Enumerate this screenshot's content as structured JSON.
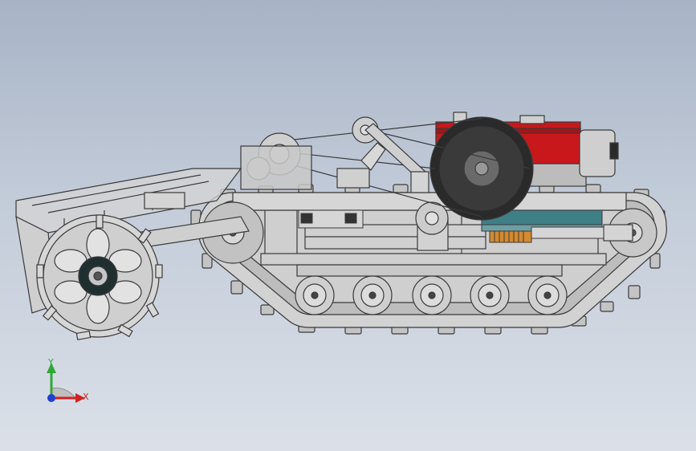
{
  "scene": {
    "background_top": "#a7b3c6",
    "background_bottom": "#dbe0e8",
    "part_fill": "#c9c9c9",
    "part_stroke": "#3a3a3a",
    "engine_color": "#c8181b",
    "hub_color": "#1f2f30",
    "cylinder_color": "#3f7f86",
    "spring_color": "#d58a2d"
  },
  "triad": {
    "y_label": "Y",
    "x_label": "X",
    "y_color": "#2ea836",
    "x_color": "#d0211f",
    "z_color": "#1f3fd0"
  }
}
